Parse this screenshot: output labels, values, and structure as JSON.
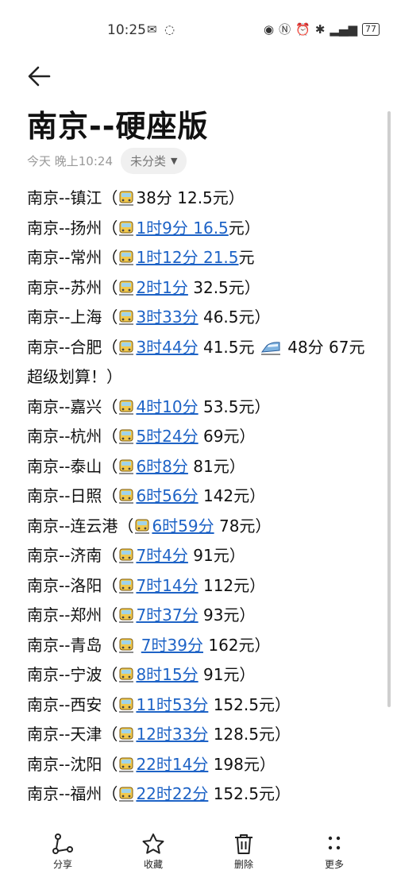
{
  "status_bar": {
    "time": "10:25",
    "battery": "77"
  },
  "note": {
    "title": "南京--硬座版",
    "date": "今天 晚上10:24",
    "category": "未分类",
    "lines": [
      [
        {
          "t": "南京--镇江（"
        },
        {
          "icon": "train"
        },
        {
          "t": "38分  12.5元）"
        }
      ],
      [
        {
          "t": "南京--扬州（"
        },
        {
          "icon": "train"
        },
        {
          "t": "1时9分 16.5",
          "link": true
        },
        {
          "t": "元）"
        }
      ],
      [
        {
          "t": "南京--常州（"
        },
        {
          "icon": "train"
        },
        {
          "t": "1时12分 21.5",
          "link": true
        },
        {
          "t": "元"
        }
      ],
      [
        {
          "t": "南京--苏州（"
        },
        {
          "icon": "train"
        },
        {
          "t": "2时1分",
          "link": true
        },
        {
          "t": " 32.5元）"
        }
      ],
      [
        {
          "t": "南京--上海（"
        },
        {
          "icon": "train"
        },
        {
          "t": "3时33分",
          "link": true
        },
        {
          "t": " 46.5元）"
        }
      ],
      [
        {
          "t": "南京--合肥（"
        },
        {
          "icon": "train"
        },
        {
          "t": "3时44分",
          "link": true
        },
        {
          "t": " 41.5元 "
        },
        {
          "icon": "bullet-train"
        },
        {
          "t": " 48分 67元 超级划算！）"
        }
      ],
      [
        {
          "t": "南京--嘉兴（"
        },
        {
          "icon": "train"
        },
        {
          "t": "4时10分",
          "link": true
        },
        {
          "t": " 53.5元）"
        }
      ],
      [
        {
          "t": "南京--杭州（"
        },
        {
          "icon": "train"
        },
        {
          "t": "5时24分",
          "link": true
        },
        {
          "t": " 69元）"
        }
      ],
      [
        {
          "t": "南京--泰山（"
        },
        {
          "icon": "train"
        },
        {
          "t": "6时8分",
          "link": true
        },
        {
          "t": " 81元）"
        }
      ],
      [
        {
          "t": "南京--日照（"
        },
        {
          "icon": "train"
        },
        {
          "t": "6时56分",
          "link": true
        },
        {
          "t": " 142元）"
        }
      ],
      [
        {
          "t": "南京--连云港（"
        },
        {
          "icon": "train"
        },
        {
          "t": "6时59分",
          "link": true
        },
        {
          "t": " 78元）"
        }
      ],
      [
        {
          "t": "南京--济南（"
        },
        {
          "icon": "train"
        },
        {
          "t": "7时4分",
          "link": true
        },
        {
          "t": " 91元）"
        }
      ],
      [
        {
          "t": "南京--洛阳（"
        },
        {
          "icon": "train"
        },
        {
          "t": "7时14分",
          "link": true
        },
        {
          "t": " 112元）"
        }
      ],
      [
        {
          "t": "南京--郑州（"
        },
        {
          "icon": "train"
        },
        {
          "t": "7时37分",
          "link": true
        },
        {
          "t": " 93元）"
        }
      ],
      [
        {
          "t": "南京--青岛（"
        },
        {
          "icon": "train"
        },
        {
          "t": " "
        },
        {
          "t": "7时39分",
          "link": true
        },
        {
          "t": " 162元）"
        }
      ],
      [
        {
          "t": "南京--宁波（"
        },
        {
          "icon": "train"
        },
        {
          "t": "8时15分",
          "link": true
        },
        {
          "t": " 91元）"
        }
      ],
      [
        {
          "t": "南京--西安（"
        },
        {
          "icon": "train"
        },
        {
          "t": "11时53分",
          "link": true
        },
        {
          "t": " 152.5元）"
        }
      ],
      [
        {
          "t": "南京--天津（"
        },
        {
          "icon": "train"
        },
        {
          "t": "12时33分",
          "link": true
        },
        {
          "t": " 128.5元）"
        }
      ],
      [
        {
          "t": "南京--沈阳（"
        },
        {
          "icon": "train"
        },
        {
          "t": "22时14分",
          "link": true
        },
        {
          "t": " 198元）"
        }
      ],
      [
        {
          "t": "南京--福州（"
        },
        {
          "icon": "train"
        },
        {
          "t": "22时22分",
          "link": true
        },
        {
          "t": " 152.5元）"
        }
      ]
    ]
  },
  "actions": {
    "share": "分享",
    "favorite": "收藏",
    "delete": "删除",
    "more": "更多"
  },
  "colors": {
    "link": "#1e63c6",
    "chip_bg": "#f0f0f0"
  }
}
